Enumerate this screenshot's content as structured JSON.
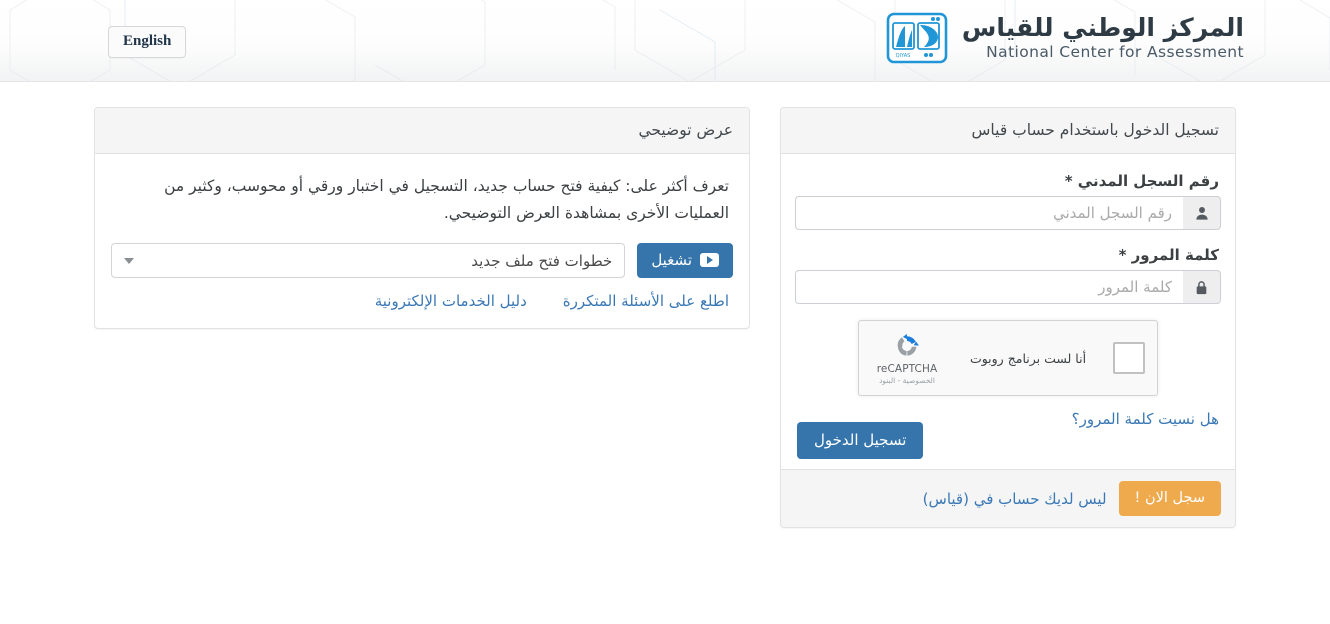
{
  "header": {
    "language_button": "English",
    "brand_ar": "المركز الوطني للقياس",
    "brand_en": "National Center for Assessment",
    "logo_text": "QIYAS"
  },
  "login": {
    "title": "تسجيل الدخول باستخدام حساب قياس",
    "id_label": "رقم السجل المدني *",
    "id_placeholder": "رقم السجل المدني",
    "id_value": "",
    "id_icon": "user-icon",
    "password_label": "كلمة المرور *",
    "password_placeholder": "كلمة المرور",
    "password_value": "",
    "password_icon": "lock-icon",
    "recaptcha": {
      "checkbox_label": "أنا لست برنامج روبوت",
      "brand_name": "reCAPTCHA",
      "legal": "الخصوصية - البنود",
      "checked": false
    },
    "forgot_password": "هل نسيت كلمة المرور؟",
    "submit_button": "تسجيل الدخول",
    "footer_text": "ليس لديك حساب في (قياس)",
    "register_button": "سجل الان !"
  },
  "demo": {
    "title": "عرض توضيحي",
    "description": "تعرف أكثر على: كيفية فتح حساب جديد، التسجيل في اختبار ورقي أو محوسب، وكثير من العمليات الأخرى بمشاهدة العرض التوضيحي.",
    "select_value": "خطوات فتح ملف جديد",
    "play_button": "تشغيل",
    "play_icon": "youtube-play-icon",
    "link_faq": "اطلع على الأسئلة المتكررة",
    "link_guide": "دليل الخدمات الإلكترونية"
  },
  "colors": {
    "primary_blue": "#3575ab",
    "link_blue": "#3a78b5",
    "accent_orange": "#eeaa4d",
    "panel_header_bg": "#f5f5f5",
    "border": "#e0e2e4"
  }
}
